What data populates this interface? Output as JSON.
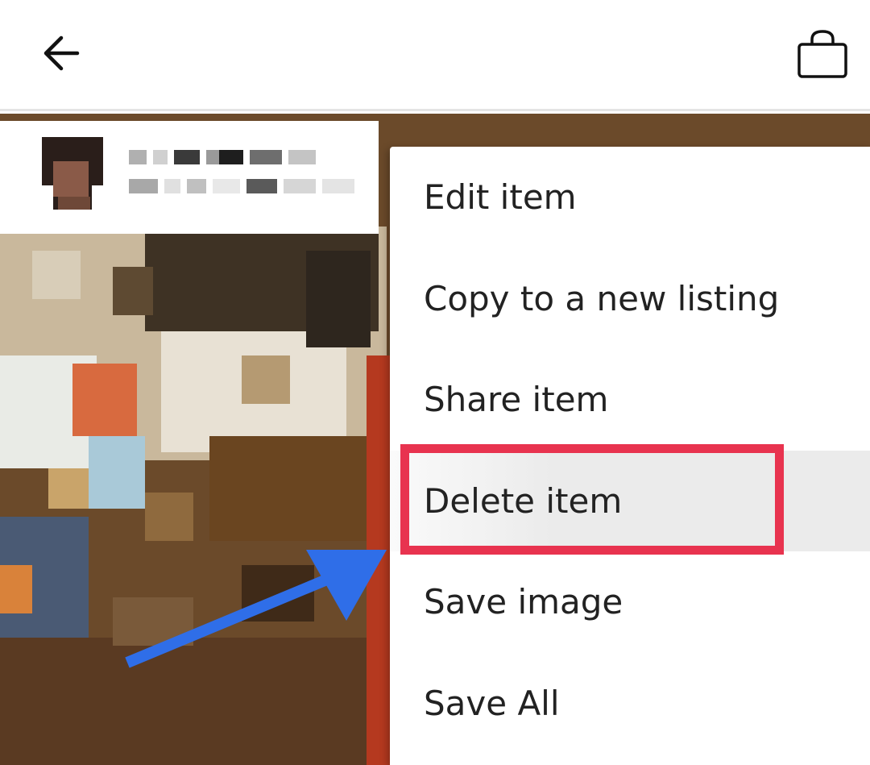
{
  "header": {
    "back_icon": "arrow-left-icon",
    "bag_icon": "shopping-bag-icon"
  },
  "menu": {
    "items": [
      {
        "label": "Edit item"
      },
      {
        "label": "Copy to a new listing"
      },
      {
        "label": "Share item"
      },
      {
        "label": "Delete item"
      },
      {
        "label": "Save image"
      },
      {
        "label": "Save All"
      }
    ]
  },
  "annotation": {
    "highlight_color": "#e8334f",
    "arrow_color": "#2f6ee8"
  }
}
